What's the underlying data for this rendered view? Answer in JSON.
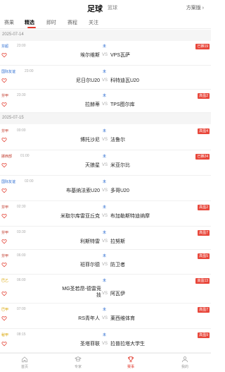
{
  "header": {
    "title": "足球",
    "subtitle": "篮球",
    "right": "方案版",
    "right_icon": "chevron-right-icon"
  },
  "tabs": [
    {
      "label": "赛果",
      "active": false
    },
    {
      "label": "精选",
      "active": true
    },
    {
      "label": "即时",
      "active": false
    },
    {
      "label": "赛程",
      "active": false
    },
    {
      "label": "关注",
      "active": false
    }
  ],
  "dates": [
    "2025-07-14",
    "2025-07-15"
  ],
  "matches": [
    {
      "league": "芬超",
      "time": "23:00",
      "status": "未",
      "badge": "已推19",
      "home": "埃尔维斯",
      "vs": "VS",
      "away": "VPS瓦萨"
    },
    {
      "league": "国际友谊",
      "time": "23:00",
      "status": "未",
      "badge": "",
      "home": "尼日尔U20",
      "vs": "VS",
      "away": "科特迪瓦U20"
    },
    {
      "league": "芬甲",
      "time": "23:30",
      "status": "未",
      "badge": "高盈2",
      "home": "拉赫蒂",
      "vs": "VS",
      "away": "TPS图尔库"
    },
    {
      "league": "芬甲",
      "time": "00:00",
      "status": "未",
      "badge": "高盈4",
      "home": "博托沙尼",
      "vs": "VS",
      "away": "法鲁尔"
    },
    {
      "league": "挪西部",
      "time": "01:00",
      "status": "未",
      "badge": "已推24",
      "home": "天狼星",
      "vs": "VS",
      "away": "米亚尔比"
    },
    {
      "league": "国际友谊",
      "time": "02:00",
      "status": "未",
      "badge": "",
      "home": "布基纳法索U20",
      "vs": "VS",
      "away": "多哥U20"
    },
    {
      "league": "芬甲",
      "time": "02:30",
      "status": "未",
      "badge": "高盈2",
      "home": "米取尔库雷亚丘克",
      "vs": "VS",
      "away": "布加勒斯特迪纳摩"
    },
    {
      "league": "芬甲",
      "time": "03:30",
      "status": "未",
      "badge": "高盈7",
      "home": "利斯特雷",
      "vs": "VS",
      "away": "拉努斯"
    },
    {
      "league": "芬甲",
      "time": "06:00",
      "status": "未",
      "badge": "高盈5",
      "home": "班菲尔德",
      "vs": "VS",
      "away": "防卫者"
    },
    {
      "league": "巴乙",
      "time": "06:00",
      "status": "未",
      "badge": "高盈13",
      "home": "MG圣若昂-德雷竞技",
      "vs": "VS",
      "away": "阿瓦伊"
    },
    {
      "league": "巴甲",
      "time": "07:00",
      "status": "未",
      "badge": "高盈7",
      "home": "RS青年人",
      "vs": "VS",
      "away": "莱西维体育"
    },
    {
      "league": "秘甲",
      "time": "08:15",
      "status": "未",
      "badge": "高盈9",
      "home": "圣塔菲联",
      "vs": "VS",
      "away": "拉普拉塔大学生"
    }
  ],
  "bottom_nav": [
    {
      "label": "首页",
      "icon": "home-icon",
      "active": false
    },
    {
      "label": "专家",
      "icon": "expert-icon",
      "active": false
    },
    {
      "label": "赛事",
      "icon": "trophy-icon",
      "active": true
    },
    {
      "label": "我的",
      "icon": "user-icon",
      "active": false
    }
  ],
  "colors": {
    "accent": "#e23a2d",
    "badge": "#e8473b",
    "status": "#2b6cd1",
    "league_a": "#2b6cd1",
    "league_b": "#c0392b",
    "league_c": "#d9a400"
  }
}
